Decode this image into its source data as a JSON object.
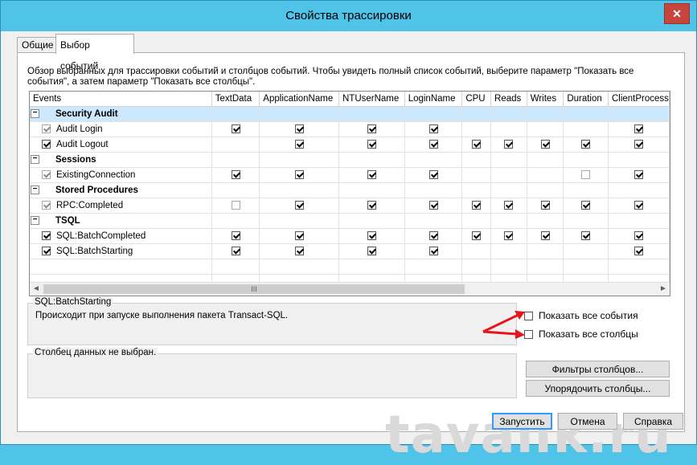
{
  "window": {
    "title": "Свойства трассировки",
    "close_glyph": "✕"
  },
  "tabs": [
    {
      "label": "Общие",
      "active": false
    },
    {
      "label": "Выбор событий",
      "active": true
    }
  ],
  "description": "Обзор выбранных для трассировки событий и столбцов событий. Чтобы увидеть полный список событий, выберите параметр \"Показать все события\", а затем параметр \"Показать все столбцы\".",
  "columns": [
    "Events",
    "TextData",
    "ApplicationName",
    "NTUserName",
    "LoginName",
    "CPU",
    "Reads",
    "Writes",
    "Duration",
    "ClientProcess"
  ],
  "rows": [
    {
      "type": "category",
      "name": "Security Audit",
      "selected": true
    },
    {
      "type": "event",
      "name": "Audit Login",
      "enabled": true,
      "disabled": true,
      "cells": [
        1,
        1,
        1,
        1,
        null,
        null,
        null,
        null,
        1
      ]
    },
    {
      "type": "event",
      "name": "Audit Logout",
      "enabled": true,
      "disabled": false,
      "cells": [
        null,
        1,
        1,
        1,
        1,
        1,
        1,
        1,
        1
      ]
    },
    {
      "type": "category",
      "name": "Sessions"
    },
    {
      "type": "event",
      "name": "ExistingConnection",
      "enabled": true,
      "disabled": true,
      "cells": [
        1,
        1,
        1,
        1,
        null,
        null,
        null,
        0,
        1
      ]
    },
    {
      "type": "category",
      "name": "Stored Procedures"
    },
    {
      "type": "event",
      "name": "RPC:Completed",
      "enabled": true,
      "disabled": true,
      "cells": [
        0,
        1,
        1,
        1,
        1,
        1,
        1,
        1,
        1
      ]
    },
    {
      "type": "category",
      "name": "TSQL"
    },
    {
      "type": "event",
      "name": "SQL:BatchCompleted",
      "enabled": true,
      "disabled": false,
      "cells": [
        1,
        1,
        1,
        1,
        1,
        1,
        1,
        1,
        1
      ]
    },
    {
      "type": "event",
      "name": "SQL:BatchStarting",
      "enabled": true,
      "disabled": false,
      "cells": [
        1,
        1,
        1,
        1,
        null,
        null,
        null,
        null,
        1
      ]
    }
  ],
  "scroll_glyphs": {
    "left": "◄",
    "right": "►",
    "grip": "III"
  },
  "event_info": {
    "legend": "SQL:BatchStarting",
    "text": "Происходит при запуске выполнения пакета Transact-SQL."
  },
  "column_info": {
    "legend": "Столбец данных не выбран."
  },
  "options": {
    "show_all_events": "Показать все события",
    "show_all_columns": "Показать все столбцы"
  },
  "buttons": {
    "column_filters": "Фильтры столбцов...",
    "organize_columns": "Упорядочить столбцы...",
    "run": "Запустить",
    "cancel": "Отмена",
    "help": "Справка"
  },
  "watermark": "tavalik.ru",
  "colors": {
    "titlebar": "#4fc3e8",
    "selection": "#cce8ff",
    "close": "#c6463e",
    "arrow": "#e8141c"
  }
}
